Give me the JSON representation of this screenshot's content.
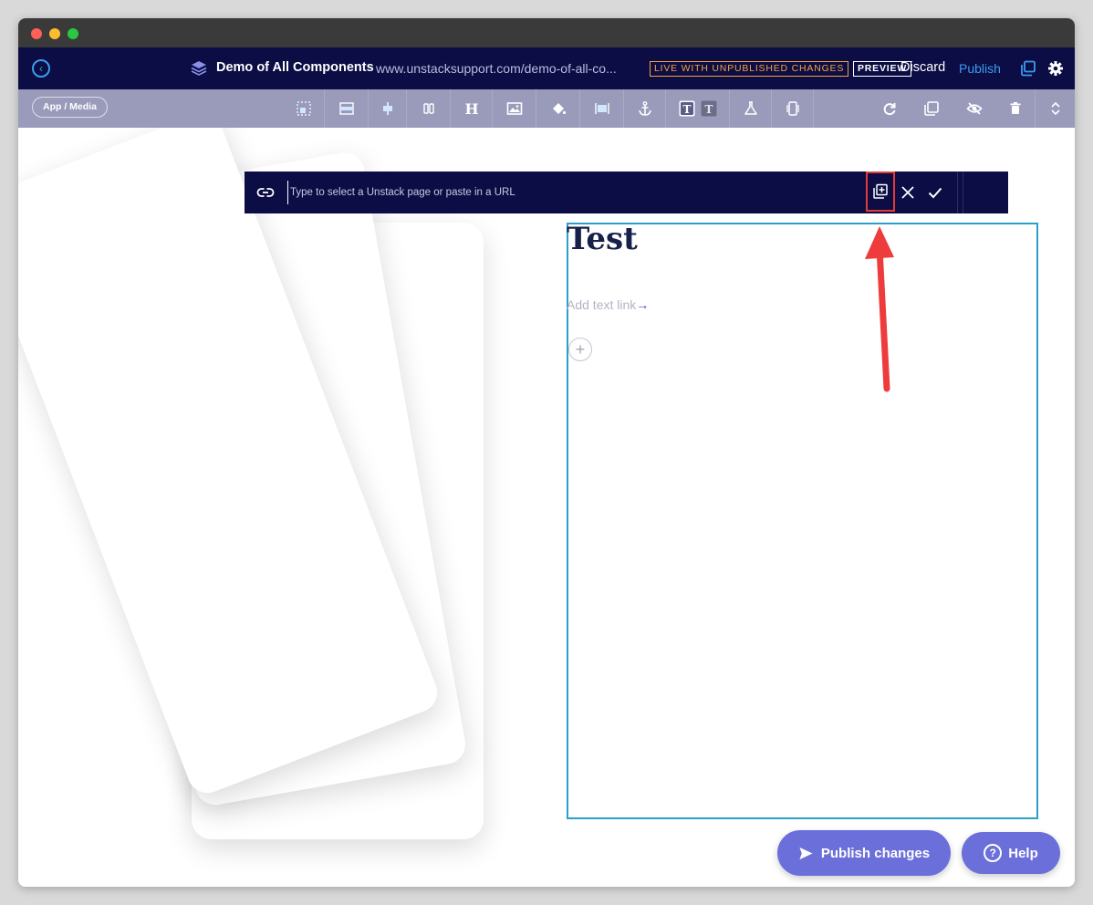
{
  "app": {
    "page_title": "Demo of All Components",
    "page_url": "www.unstacksupport.com/demo-of-all-co...",
    "status_badge": "LIVE WITH UNPUBLISHED CHANGES",
    "preview_label": "PREVIEW",
    "discard_label": "Discard",
    "publish_label": "Publish"
  },
  "toolbar": {
    "breadcrumb": "App / Media",
    "tools": [
      "layout-icon",
      "section-icon",
      "align-icon",
      "columns-icon",
      "heading-icon",
      "image-icon",
      "paint-bucket-icon",
      "width-icon",
      "anchor-icon",
      "text-style-icon",
      "experiment-icon",
      "mobile-icon",
      "refresh-icon",
      "duplicate-icon",
      "hide-icon",
      "trash-icon",
      "reorder-icon"
    ]
  },
  "link_editor": {
    "placeholder": "Type to select a Unstack page or paste in a URL",
    "value": ""
  },
  "content": {
    "heading": "Test",
    "text_link": "Add text link",
    "text_link_arrow": "→"
  },
  "footer": {
    "publish_changes": "Publish changes",
    "help": "Help"
  },
  "colors": {
    "navbar": "#0b0d44",
    "toolbar": "#9a9bbb",
    "accent": "#6b6fd9",
    "warning": "#f5a13c",
    "selection": "#2aa0c8",
    "annotation": "#e53935"
  }
}
